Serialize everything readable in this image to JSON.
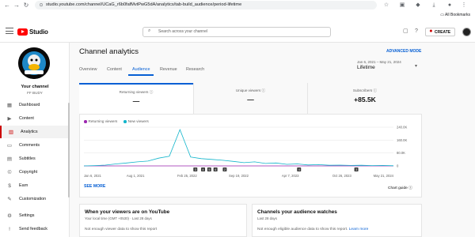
{
  "browser": {
    "url": "studio.youtube.com/channel/UCaG_r6b0fafMvtPwG5dA/analytics/tab-build_audience/period-lifetime",
    "bookmarks_label": "All Bookmarks"
  },
  "header": {
    "logo_text": "Studio",
    "search_placeholder": "Search across your channel",
    "create_label": "CREATE"
  },
  "sidebar": {
    "your_channel": "Your channel",
    "channel_name": "FF BUDY",
    "items": [
      {
        "label": "Dashboard",
        "icon": "dashboard-icon",
        "glyph": "▦"
      },
      {
        "label": "Content",
        "icon": "content-icon",
        "glyph": "▶"
      },
      {
        "label": "Analytics",
        "icon": "analytics-icon",
        "glyph": "▥"
      },
      {
        "label": "Comments",
        "icon": "comments-icon",
        "glyph": "▭"
      },
      {
        "label": "Subtitles",
        "icon": "subtitles-icon",
        "glyph": "▤"
      },
      {
        "label": "Copyright",
        "icon": "copyright-icon",
        "glyph": "©"
      },
      {
        "label": "Earn",
        "icon": "earn-icon",
        "glyph": "$"
      },
      {
        "label": "Customization",
        "icon": "customization-icon",
        "glyph": "✎"
      },
      {
        "label": "Settings",
        "icon": "settings-icon",
        "glyph": "⚙"
      },
      {
        "label": "Send feedback",
        "icon": "feedback-icon",
        "glyph": "!"
      }
    ]
  },
  "main": {
    "title": "Channel analytics",
    "advanced_mode": "ADVANCED MODE",
    "tabs": [
      "Overview",
      "Content",
      "Audience",
      "Revenue",
      "Research"
    ],
    "active_tab": "Audience",
    "date_range": "Jan 6, 2021 – May 21, 2024",
    "date_label": "Lifetime",
    "metrics": [
      {
        "label": "Returning viewers",
        "value": "—"
      },
      {
        "label": "Unique viewers",
        "value": "—"
      },
      {
        "label": "Subscribers",
        "value": "+85.5K"
      }
    ],
    "legend": [
      "Returning viewers",
      "New viewers"
    ],
    "see_more": "SEE MORE",
    "chart_guide": "Chart guide"
  },
  "chart_data": {
    "type": "line",
    "x_ticks": [
      "Jan 6, 2021",
      "Aug 1, 2021",
      "Feb 25, 2022",
      "Sep 19, 2022",
      "Apr 7, 2023",
      "Oct 26, 2023",
      "May 21, 2024"
    ],
    "y_ticks": [
      "240.0K",
      "160.0K",
      "80.0K",
      "0"
    ],
    "ylim": [
      0,
      240000
    ],
    "series": [
      {
        "name": "Returning viewers",
        "color": "#9c27b0",
        "values": [
          0,
          0,
          0,
          0,
          0,
          0,
          0,
          0,
          0,
          0,
          0,
          0,
          0,
          0,
          0,
          0,
          0,
          0,
          0,
          0,
          0,
          0,
          0,
          0,
          0,
          0,
          0,
          0,
          0,
          0
        ]
      },
      {
        "name": "New viewers",
        "color": "#12b5cb",
        "values": [
          0,
          2000,
          5000,
          12000,
          18000,
          25000,
          30000,
          48000,
          60000,
          225000,
          55000,
          45000,
          40000,
          35000,
          28000,
          20000,
          25000,
          15000,
          18000,
          10000,
          12000,
          6000,
          8000,
          4000,
          5000,
          3000,
          4000,
          2000,
          3000,
          1000
        ]
      }
    ],
    "markers": [
      "3",
      "4",
      "5",
      "4",
      "2",
      "4",
      "3"
    ]
  },
  "bottom": {
    "card1_title": "When your viewers are on YouTube",
    "card1_sub": "Your local time (GMT +0530) · Last 28 days",
    "card1_body": "Not enough viewer data to show this report",
    "card2_title": "Channels your audience watches",
    "card2_sub": "Last 28 days",
    "card2_body": "Not enough eligible audience data to show this report.",
    "card2_link": "Learn more"
  },
  "colors": {
    "accent": "#065fd4",
    "brand": "#ff0000"
  }
}
